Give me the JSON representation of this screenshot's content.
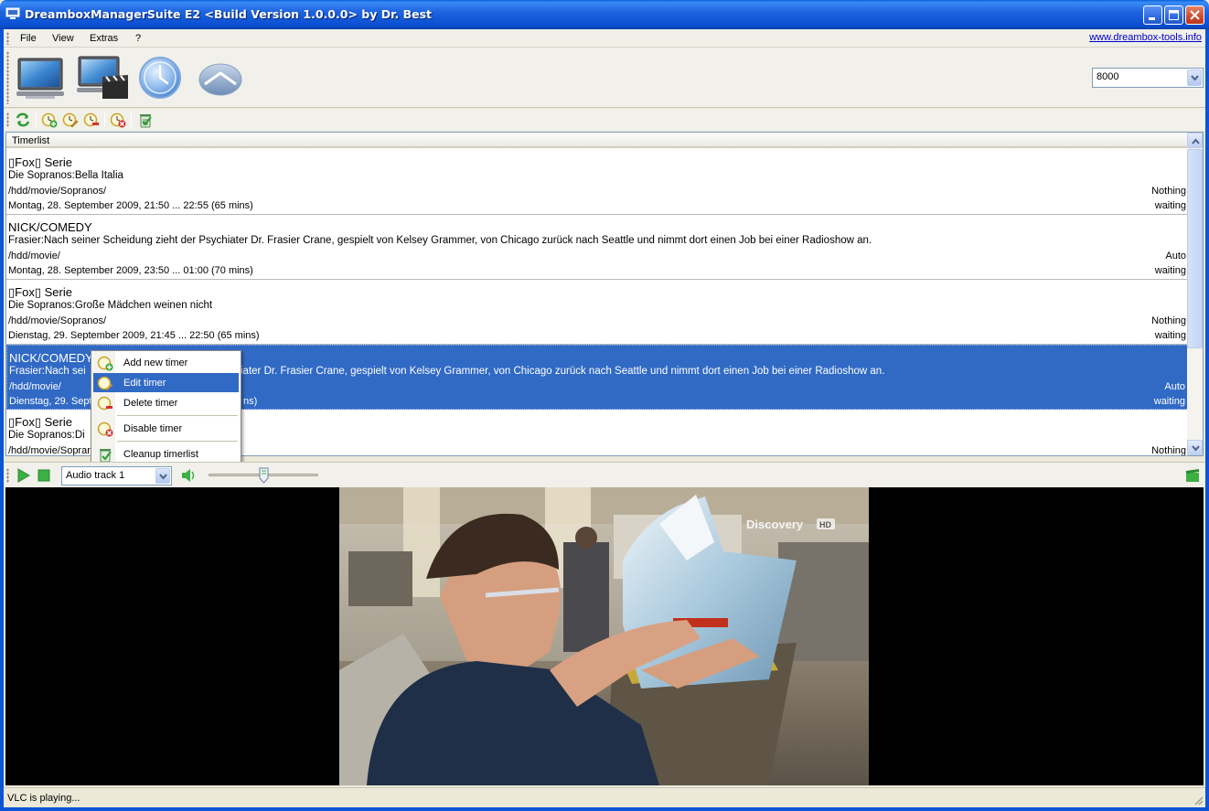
{
  "window": {
    "title": "DreamboxManagerSuite E2 <Build Version 1.0.0.0> by Dr. Best"
  },
  "menu": {
    "items": [
      "File",
      "View",
      "Extras",
      "?"
    ],
    "link": "www.dreambox-tools.info"
  },
  "toolbar": {
    "port_value": "8000"
  },
  "timerlist": {
    "header": "Timerlist",
    "rows": [
      {
        "channel": "▯Fox▯ Serie",
        "description": "Die Sopranos:Bella Italia",
        "path": "/hdd/movie/Sopranos/",
        "time": "Montag, 28. September 2009, 21:50 ... 22:55 (65 mins)",
        "action": "Nothing",
        "status": "waiting"
      },
      {
        "channel": "NICK/COMEDY",
        "description": "Frasier:Nach seiner Scheidung zieht der Psychiater Dr. Frasier Crane, gespielt von Kelsey Grammer, von Chicago zurück nach Seattle und nimmt dort einen Job bei einer Radioshow an.",
        "path": "/hdd/movie/",
        "time": "Montag, 28. September 2009, 23:50 ... 01:00 (70 mins)",
        "action": "Auto",
        "status": "waiting"
      },
      {
        "channel": "▯Fox▯ Serie",
        "description": "Die Sopranos:Große Mädchen weinen nicht",
        "path": "/hdd/movie/Sopranos/",
        "time": "Dienstag, 29. September 2009, 21:45 ... 22:50 (65 mins)",
        "action": "Nothing",
        "status": "waiting"
      },
      {
        "channel": "NICK/COMEDY",
        "description_visible": "Frasier:Nach sei",
        "description_tail": "iater Dr. Frasier Crane, gespielt von Kelsey Grammer, von Chicago zurück nach Seattle und nimmt dort einen Job bei einer Radioshow an.",
        "path": "/hdd/movie/",
        "time_visible": "Dienstag, 29. Sept",
        "time_tail": "ns)",
        "action": "Auto",
        "status": "waiting"
      },
      {
        "channel": "▯Fox▯ Serie",
        "description_visible": "Die Sopranos:Di",
        "path_visible": "/hdd/movie/Sopran",
        "action": "Nothing"
      }
    ]
  },
  "context_menu": {
    "items": [
      {
        "label": "Add new timer"
      },
      {
        "label": "Edit timer"
      },
      {
        "label": "Delete timer"
      },
      {
        "label": "Disable timer"
      },
      {
        "label": "Cleanup timerlist"
      }
    ]
  },
  "player": {
    "audio_track": "Audio track 1",
    "volume_level": 0.5
  },
  "video": {
    "watermark": "Discovery",
    "watermark_badge": "HD"
  },
  "status": {
    "text": "VLC is playing..."
  },
  "colors": {
    "titlebar": "#0a4fd0",
    "selection": "#316ac5",
    "link": "#0000cc",
    "play_green": "#3cb043"
  }
}
